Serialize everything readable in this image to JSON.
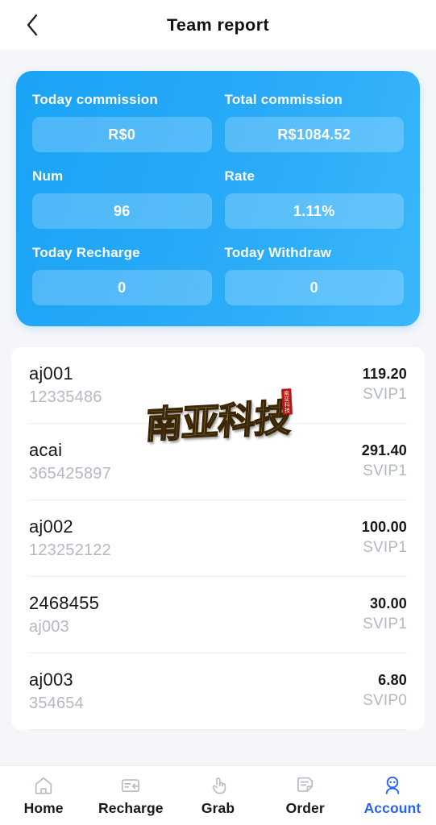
{
  "header": {
    "title": "Team report",
    "back_icon": "chevron-left-icon"
  },
  "stats": {
    "cells": [
      {
        "label": "Today commission",
        "value": "R$0"
      },
      {
        "label": "Total commission",
        "value": "R$1084.52"
      },
      {
        "label": "Num",
        "value": "96"
      },
      {
        "label": "Rate",
        "value": "1.11%"
      },
      {
        "label": "Today Recharge",
        "value": "0"
      },
      {
        "label": "Today Withdraw",
        "value": "0"
      }
    ],
    "card_color": "#26a9f7",
    "pill_color": "rgba(255,255,255,0.22)"
  },
  "members": {
    "rows": [
      {
        "name": "aj001",
        "id": "12335486",
        "amount": "119.20",
        "level": "SVIP1"
      },
      {
        "name": "acai",
        "id": "365425897",
        "amount": "291.40",
        "level": "SVIP1"
      },
      {
        "name": "aj002",
        "id": "123252122",
        "amount": "100.00",
        "level": "SVIP1"
      },
      {
        "name": "2468455",
        "id": "aj003",
        "amount": "30.00",
        "level": "SVIP1"
      },
      {
        "name": "aj003",
        "id": "354654",
        "amount": "6.80",
        "level": "SVIP0"
      }
    ]
  },
  "watermark": {
    "text": "南亚科技",
    "seal": "南亚科技"
  },
  "tabbar": {
    "active_color": "#2563f5",
    "items": [
      {
        "label": "Home",
        "icon": "home-icon",
        "active": false
      },
      {
        "label": "Recharge",
        "icon": "card-in-icon",
        "active": false
      },
      {
        "label": "Grab",
        "icon": "tap-hand-icon",
        "active": false
      },
      {
        "label": "Order",
        "icon": "document-icon",
        "active": false
      },
      {
        "label": "Account",
        "icon": "account-icon",
        "active": true
      }
    ]
  }
}
